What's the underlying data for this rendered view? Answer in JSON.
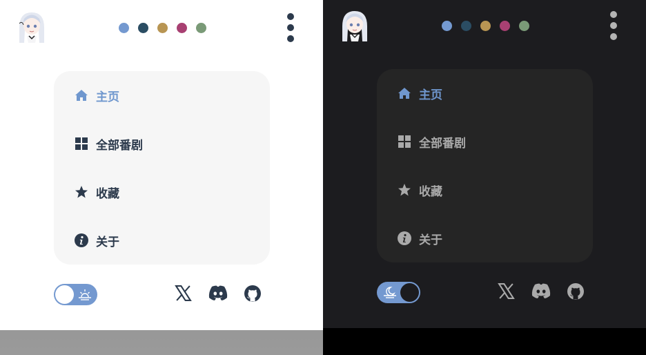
{
  "colors": {
    "accent": "#6f97ce",
    "dots": [
      "#7499d0",
      "#2b4d63",
      "#b89553",
      "#a84072",
      "#7a9a77"
    ],
    "light_text": "#2c3a4c",
    "dark_text": "#a9a9a9"
  },
  "views": [
    {
      "theme": "light",
      "menu": [
        {
          "label": "主页",
          "icon": "home-icon",
          "active": true
        },
        {
          "label": "全部番剧",
          "icon": "grid-icon",
          "active": false
        },
        {
          "label": "收藏",
          "icon": "star-icon",
          "active": false
        },
        {
          "label": "关于",
          "icon": "info-icon",
          "active": false
        }
      ],
      "theme_toggle": {
        "state": "off",
        "icon": "sunrise-icon"
      },
      "social": [
        "x-icon",
        "discord-icon",
        "github-icon"
      ]
    },
    {
      "theme": "dark",
      "menu": [
        {
          "label": "主页",
          "icon": "home-icon",
          "active": true
        },
        {
          "label": "全部番剧",
          "icon": "grid-icon",
          "active": false
        },
        {
          "label": "收藏",
          "icon": "star-icon",
          "active": false
        },
        {
          "label": "关于",
          "icon": "info-icon",
          "active": false
        }
      ],
      "theme_toggle": {
        "state": "on",
        "icon": "moon-icon"
      },
      "social": [
        "x-icon",
        "discord-icon",
        "github-icon"
      ]
    }
  ]
}
